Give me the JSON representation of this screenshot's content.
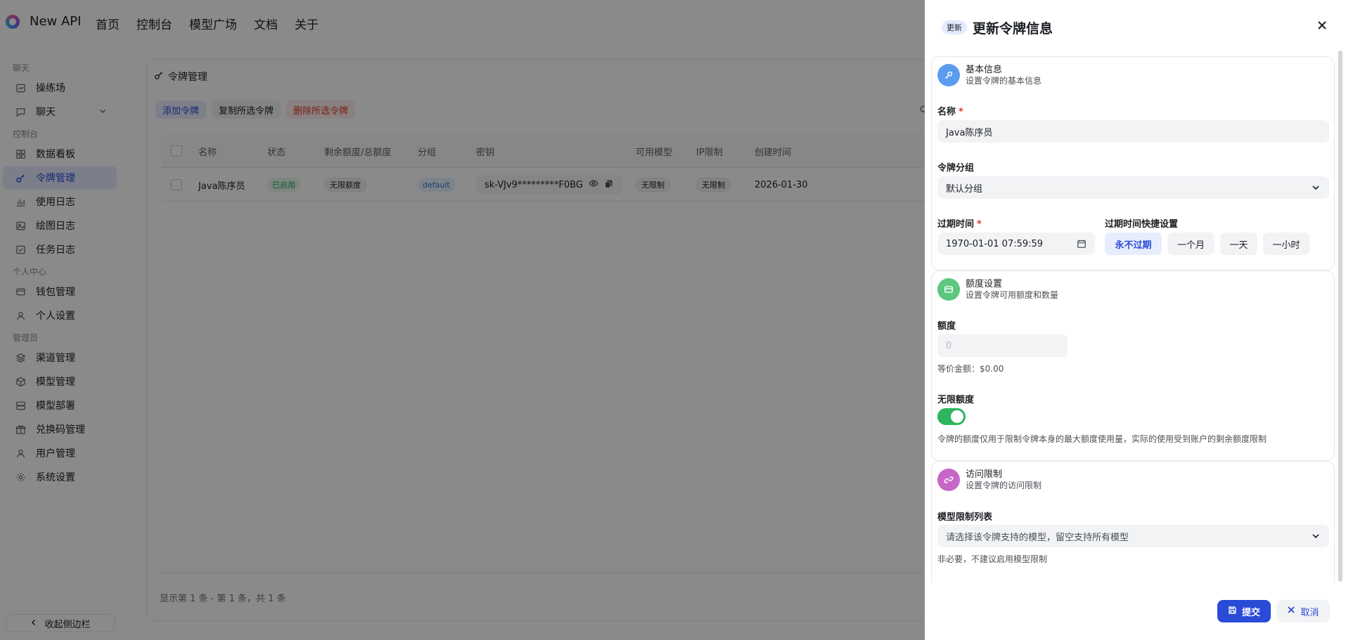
{
  "app": {
    "brand": "New API",
    "nav": [
      "首页",
      "控制台",
      "模型广场",
      "文档",
      "关于"
    ]
  },
  "sidebar": {
    "sections": [
      {
        "title": "聊天",
        "items": [
          {
            "label": "操练场",
            "icon": "playground-icon"
          },
          {
            "label": "聊天",
            "icon": "chat-icon"
          }
        ]
      },
      {
        "title": "控制台",
        "items": [
          {
            "label": "数据看板",
            "icon": "dashboard-icon"
          },
          {
            "label": "令牌管理",
            "icon": "key-icon"
          },
          {
            "label": "使用日志",
            "icon": "chart-icon"
          },
          {
            "label": "绘图日志",
            "icon": "image-icon"
          },
          {
            "label": "任务日志",
            "icon": "task-icon"
          }
        ]
      },
      {
        "title": "个人中心",
        "items": [
          {
            "label": "钱包管理",
            "icon": "wallet-icon"
          },
          {
            "label": "个人设置",
            "icon": "user-icon"
          }
        ]
      },
      {
        "title": "管理员",
        "items": [
          {
            "label": "渠道管理",
            "icon": "layers-icon"
          },
          {
            "label": "模型管理",
            "icon": "cube-icon"
          },
          {
            "label": "模型部署",
            "icon": "server-icon"
          },
          {
            "label": "兑换码管理",
            "icon": "gift-icon"
          },
          {
            "label": "用户管理",
            "icon": "user-icon"
          },
          {
            "label": "系统设置",
            "icon": "gear-icon"
          }
        ]
      }
    ],
    "active": "令牌管理",
    "collapse_label": "收起侧边栏"
  },
  "tokens_page": {
    "title": "令牌管理",
    "buttons": {
      "add": "添加令牌",
      "copy": "复制所选令牌",
      "delete": "删除所选令牌"
    },
    "columns": [
      "名称",
      "状态",
      "剩余额度/总额度",
      "分组",
      "密钥",
      "可用模型",
      "IP限制",
      "创建时间"
    ],
    "rows": [
      {
        "name": "Java陈序员",
        "status": "已启用",
        "quota": "无限额度",
        "group": "default",
        "key": "sk-VJv9*********F0BG",
        "models": "无限制",
        "ip": "无限制",
        "created": "2026-01-30"
      }
    ],
    "pagination": "显示第 1 条 - 第 1 条，共 1 条"
  },
  "sheet": {
    "badge": "更新",
    "title": "更新令牌信息",
    "basic": {
      "title": "基本信息",
      "subtitle": "设置令牌的基本信息",
      "name_label": "名称",
      "name_value": "Java陈序员",
      "group_label": "令牌分组",
      "group_value": "默认分组",
      "expire_label": "过期时间",
      "expire_value": "1970-01-01 07:59:59",
      "quick_label": "过期时间快捷设置",
      "quick_options": [
        "永不过期",
        "一个月",
        "一天",
        "一小时"
      ],
      "quick_selected": "永不过期"
    },
    "quota": {
      "title": "额度设置",
      "subtitle": "设置令牌可用额度和数量",
      "quota_label": "额度",
      "quota_placeholder": "0",
      "equivalent": "等价金额：$0.00",
      "unlimited_label": "无限额度",
      "unlimited_on": true,
      "note": "令牌的额度仅用于限制令牌本身的最大额度使用量，实际的使用受到账户的剩余额度限制"
    },
    "access": {
      "title": "访问限制",
      "subtitle": "设置令牌的访问限制",
      "models_label": "模型限制列表",
      "models_placeholder": "请选择该令牌支持的模型，留空支持所有模型",
      "models_hint": "非必要，不建议启用模型限制"
    },
    "submit": "提交",
    "cancel": "取消"
  },
  "colors": {
    "accent": "#2a4bd7",
    "success": "#2db55d",
    "danger": "#e0382e",
    "overlay": "rgba(0,0,0,0.46)"
  }
}
